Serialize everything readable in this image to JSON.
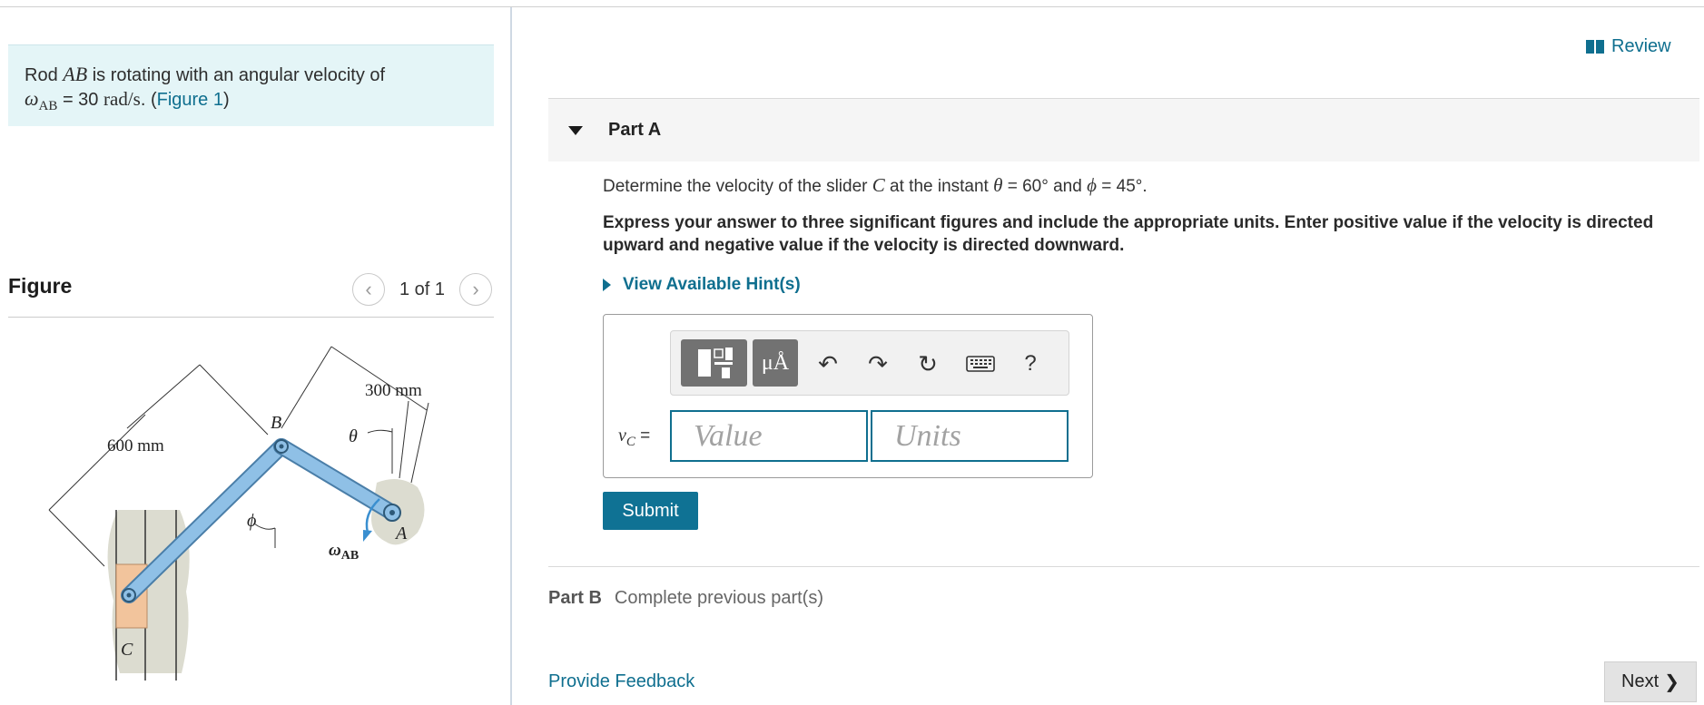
{
  "problem": {
    "text_prefix": "Rod ",
    "rod_name": "AB",
    "text_middle": " is rotating with an angular velocity of",
    "omega_symbol": "ω",
    "omega_sub": "AB",
    "equals_value": " = 30 ",
    "unit": "rad/s",
    "period_open": ". (",
    "figure_link": "Figure 1",
    "close": ")"
  },
  "figure": {
    "heading": "Figure",
    "pager_text": "1 of 1",
    "prev_glyph": "‹",
    "next_glyph": "›",
    "labels": {
      "dim_600": "600 mm",
      "dim_300": "300 mm",
      "point_B": "B",
      "point_A": "A",
      "point_C": "C",
      "theta": "θ",
      "phi": "ϕ",
      "omega": "ω",
      "omega_sub": "AB"
    },
    "colors": {
      "rod": "#8fc0e6",
      "rod_edge": "#4a7ea8",
      "wall": "#dcdcd0",
      "slider": "#f2c49c",
      "arrow": "#3a8fd0"
    }
  },
  "header": {
    "review_label": "Review",
    "review_icon": "book-icon"
  },
  "partA": {
    "title": "Part A",
    "question": {
      "t1": "Determine the velocity of the slider ",
      "c": "C",
      "t2": " at the instant ",
      "theta": "θ",
      "t3": " = 60° and ",
      "phi": "ϕ",
      "t4": " = 45°."
    },
    "instructions": "Express your answer to three significant figures and include the appropriate units. Enter positive value if the velocity is directed upward and negative value if the velocity is  directed downward.",
    "hints_label": "View Available Hint(s)",
    "toolbar": {
      "template_icon": "templates-icon",
      "units_glyph": "μÅ",
      "undo_glyph": "↶",
      "redo_glyph": "↷",
      "reset_glyph": "↻",
      "keyboard_icon": "keyboard-icon",
      "help_glyph": "?"
    },
    "answer": {
      "var": "v",
      "var_sub": "C",
      "eq": " =",
      "value_placeholder": "Value",
      "units_placeholder": "Units"
    },
    "submit_label": "Submit"
  },
  "partB": {
    "title": "Part B",
    "status": "Complete previous part(s)"
  },
  "footer": {
    "feedback_label": "Provide Feedback",
    "next_label": "Next",
    "next_glyph": "❯"
  }
}
